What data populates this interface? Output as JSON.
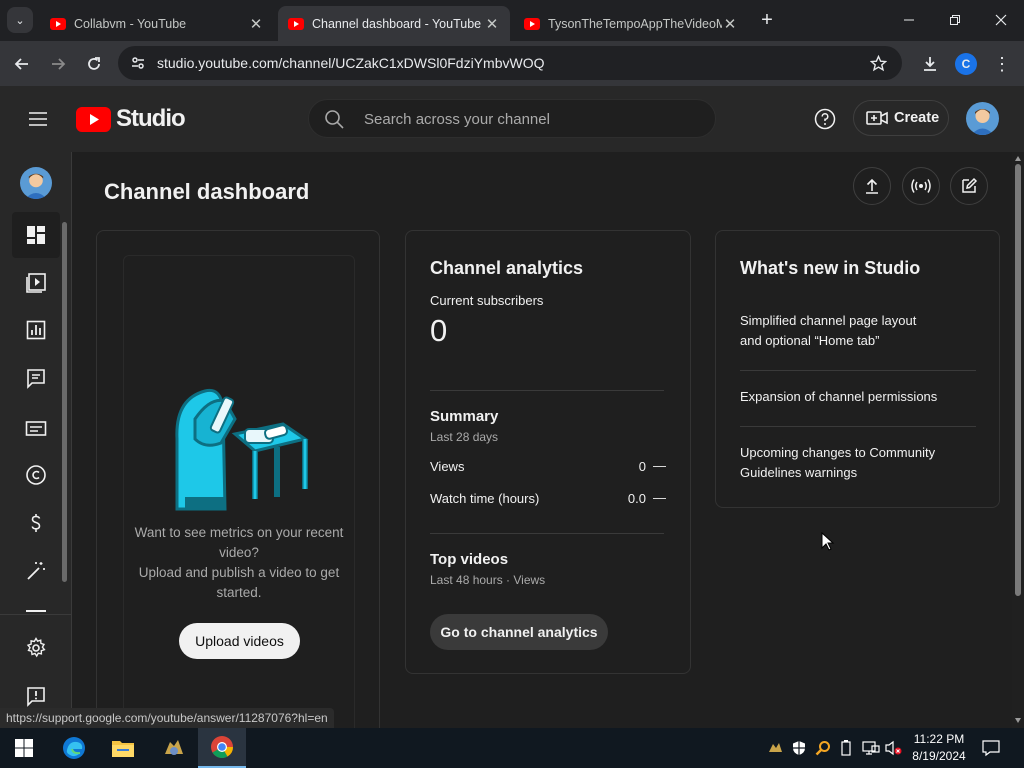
{
  "browser": {
    "tabs": [
      {
        "title": "Collabvm - YouTube",
        "active": false
      },
      {
        "title": "Channel dashboard - YouTube Studio",
        "active": true
      },
      {
        "title": "TysonTheTempoAppTheVideoMaker",
        "active": false
      }
    ],
    "url": "studio.youtube.com/channel/UCZakC1xDWSl0FdziYmbvWOQ",
    "profile_initial": "C"
  },
  "studio": {
    "logo_text": "Studio",
    "search_placeholder": "Search across your channel",
    "create_label": "Create"
  },
  "sidebar": {
    "items": [
      {
        "name": "dashboard",
        "icon": "dashboard-icon",
        "selected": true
      },
      {
        "name": "content",
        "icon": "content-icon"
      },
      {
        "name": "analytics",
        "icon": "analytics-icon"
      },
      {
        "name": "comments",
        "icon": "comments-icon"
      },
      {
        "name": "subtitles",
        "icon": "subtitles-icon"
      },
      {
        "name": "copyright",
        "icon": "copyright-icon"
      },
      {
        "name": "earn",
        "icon": "earn-icon"
      },
      {
        "name": "customization",
        "icon": "magic-wand-icon"
      }
    ],
    "bottom_items": [
      {
        "name": "settings",
        "icon": "gear-icon"
      },
      {
        "name": "feedback",
        "icon": "feedback-icon"
      }
    ]
  },
  "dashboard": {
    "title": "Channel dashboard",
    "upload_card": {
      "message_line1": "Want to see metrics on your recent",
      "message_line2": "video?",
      "message_line3": "Upload and publish a video to get",
      "message_line4": "started.",
      "button_label": "Upload videos"
    },
    "analytics_card": {
      "title": "Channel analytics",
      "subscribers_label": "Current subscribers",
      "subscribers_value": "0",
      "summary_title": "Summary",
      "summary_period": "Last 28 days",
      "rows": [
        {
          "label": "Views",
          "value": "0",
          "trend": "—"
        },
        {
          "label": "Watch time (hours)",
          "value": "0.0",
          "trend": "—"
        }
      ],
      "top_videos_title": "Top videos",
      "top_videos_period": "Last 48 hours · Views",
      "button_label": "Go to channel analytics"
    },
    "whats_new_card": {
      "title": "What's new in Studio",
      "items": [
        {
          "line1": "Simplified channel page layout",
          "line2": "and optional “Home tab”"
        },
        {
          "line1": "Expansion of channel permissions",
          "line2": ""
        },
        {
          "line1": "Upcoming changes to Community",
          "line2": "Guidelines warnings"
        }
      ]
    }
  },
  "status_url": "https://support.google.com/youtube/answer/11287076?hl=en",
  "taskbar": {
    "time": "11:22 PM",
    "date": "8/19/2024"
  },
  "colors": {
    "youtube_red": "#ff0000",
    "background": "#1f1f1f",
    "surface": "#282828",
    "text": "#f1f1f1",
    "muted_text": "#aaaaaa"
  }
}
